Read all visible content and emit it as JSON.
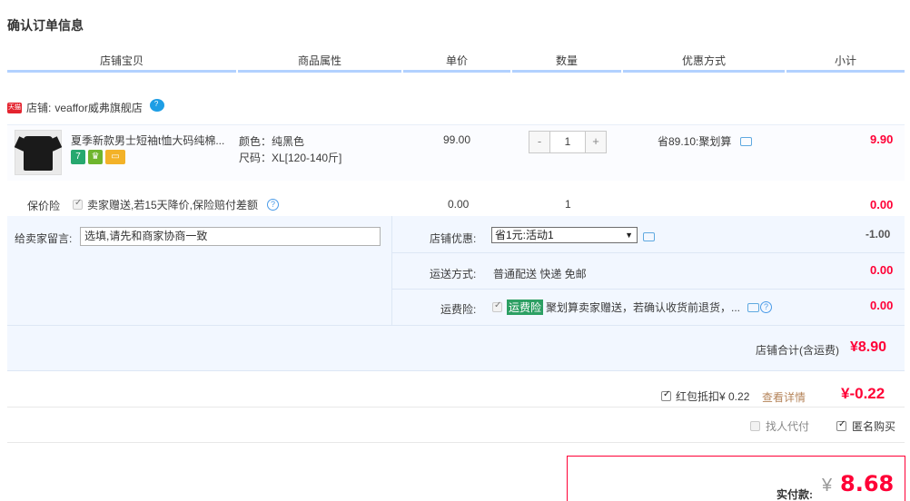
{
  "page_title": "确认订单信息",
  "columns": [
    "店铺宝贝",
    "商品属性",
    "单价",
    "数量",
    "优惠方式",
    "小计"
  ],
  "shop": {
    "badge": "天猫",
    "prefix": "店铺:",
    "name": "veaffor威弗旗舰店"
  },
  "item": {
    "title": "夏季新款男士短袖t恤大码纯棉...",
    "service_icons": [
      "seven-day-return-icon",
      "gold-guarantee-icon",
      "card-payment-icon"
    ],
    "attrs": [
      "颜色：纯黑色",
      "尺码：XL[120-140斤]"
    ],
    "unit_price": "99.00",
    "qty_minus": "-",
    "quantity": "1",
    "qty_plus": "+",
    "discount": "省89.10:聚划算",
    "subtotal": "9.90"
  },
  "insurance": {
    "label": "保价险",
    "text": "卖家赠送,若15天降价,保险赔付差额",
    "price": "0.00",
    "qty": "1",
    "amount": "0.00"
  },
  "memo": {
    "label": "给卖家留言:",
    "value": "选填,请先和商家协商一致"
  },
  "shop_promo": {
    "label": "店铺优惠:",
    "selected": "省1元:活动1",
    "amount": "-1.00"
  },
  "delivery": {
    "label": "运送方式:",
    "value": "普通配送 快递 免邮",
    "amount": "0.00"
  },
  "freight_insurance": {
    "label": "运费险:",
    "badge": "运费险",
    "text": "聚划算卖家赠送，若确认收货前退货，...",
    "amount": "0.00"
  },
  "shop_total": {
    "label": "店铺合计(含运费)",
    "value": "¥8.90"
  },
  "red_packet": {
    "label": "红包抵扣¥ 0.22",
    "link": "查看详情",
    "amount": "¥-0.22"
  },
  "options": {
    "proxy_pay": "找人代付",
    "anonymous": "匿名购买"
  },
  "payment": {
    "label": "实付款:",
    "currency": "¥",
    "value": "8.68"
  },
  "colors": {
    "accent_red": "#ff0036",
    "header_underline": "#b2d1ff",
    "panel_bg": "#f2f7ff"
  }
}
